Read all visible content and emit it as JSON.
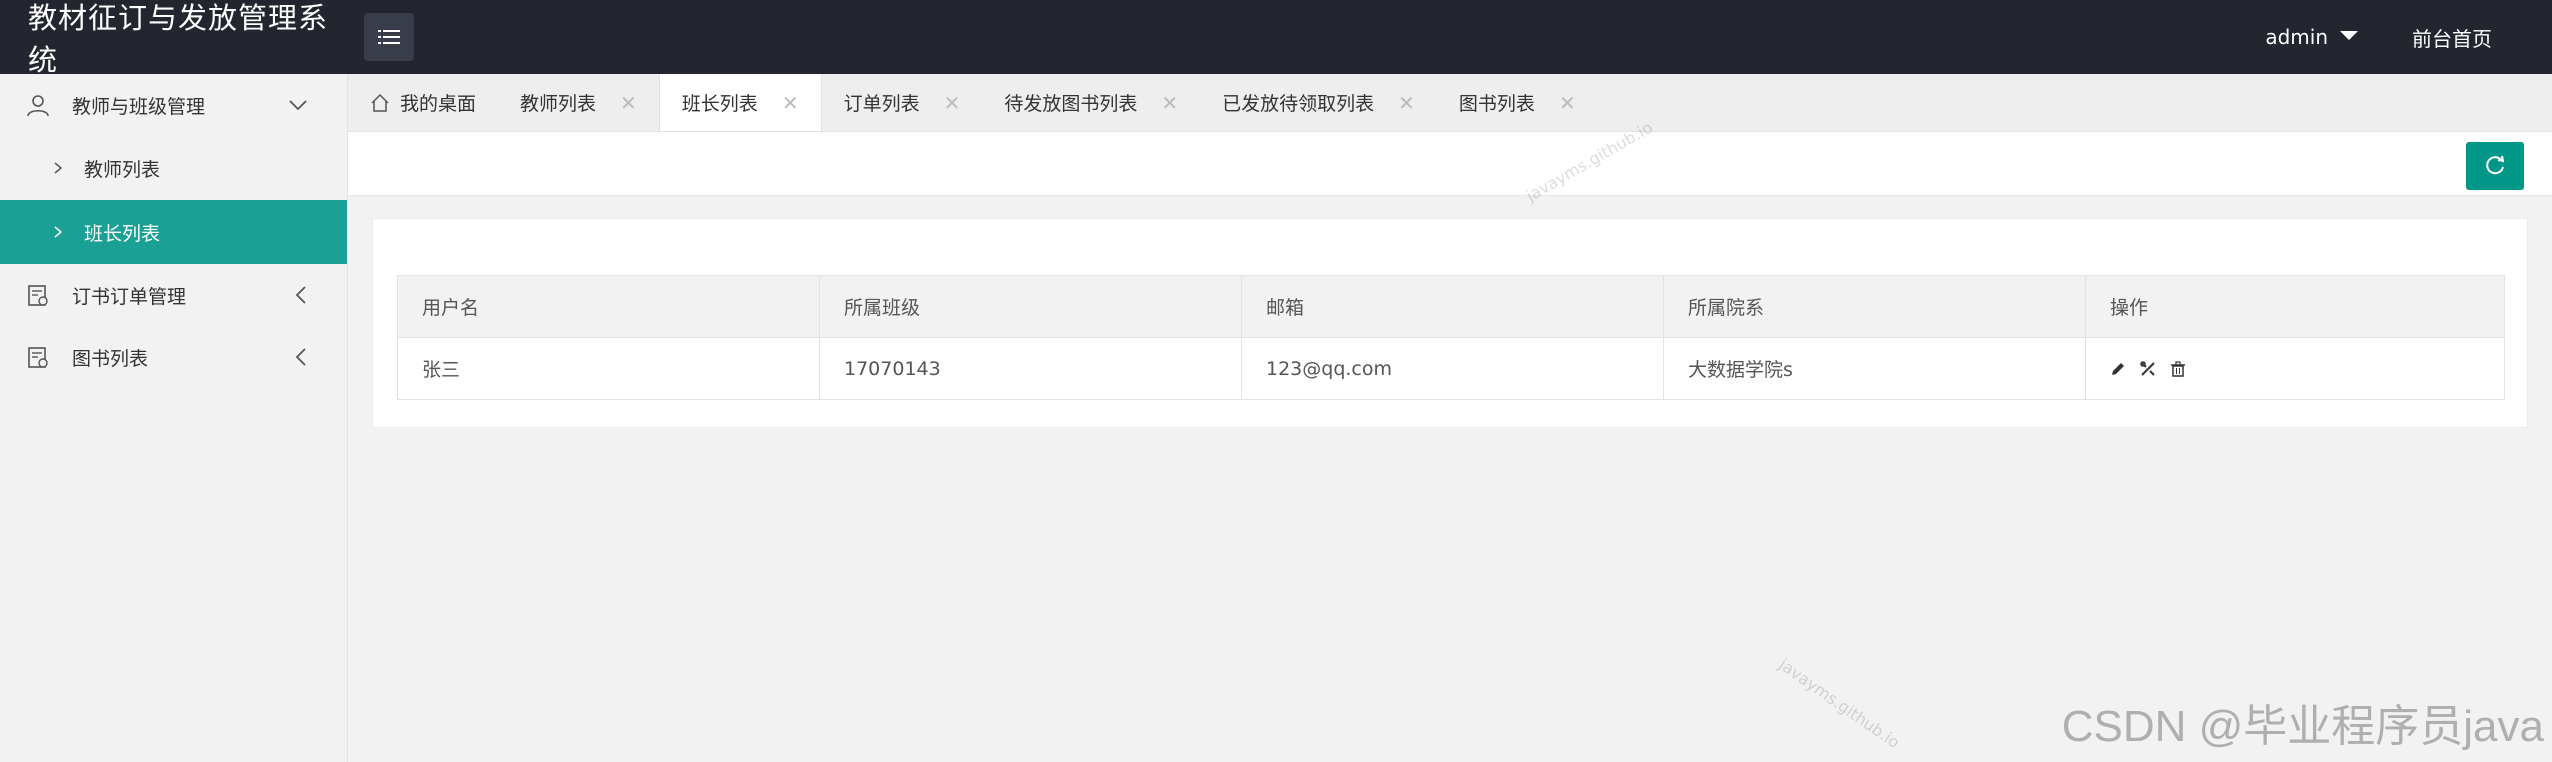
{
  "app": {
    "title": "教材征订与发放管理系统"
  },
  "header": {
    "user": "admin",
    "front_link": "前台首页"
  },
  "sidebar": {
    "groups": [
      {
        "label": "教师与班级管理",
        "icon": "user-icon",
        "expanded": true,
        "items": [
          {
            "label": "教师列表",
            "active": false
          },
          {
            "label": "班长列表",
            "active": true
          }
        ]
      },
      {
        "label": "订书订单管理",
        "icon": "calendar-icon",
        "expanded": false
      },
      {
        "label": "图书列表",
        "icon": "calendar-icon",
        "expanded": false
      }
    ]
  },
  "tabs": [
    {
      "label": "我的桌面",
      "icon": "home-icon",
      "closable": false,
      "active": false
    },
    {
      "label": "教师列表",
      "closable": true,
      "active": false
    },
    {
      "label": "班长列表",
      "closable": true,
      "active": true
    },
    {
      "label": "订单列表",
      "closable": true,
      "active": false
    },
    {
      "label": "待发放图书列表",
      "closable": true,
      "active": false
    },
    {
      "label": "已发放待领取列表",
      "closable": true,
      "active": false
    },
    {
      "label": "图书列表",
      "closable": true,
      "active": false
    }
  ],
  "table": {
    "columns": [
      "用户名",
      "所属班级",
      "邮箱",
      "所属院系",
      "操作"
    ],
    "rows": [
      {
        "username": "张三",
        "class": "17070143",
        "email": "123@qq.com",
        "department": "大数据学院s"
      }
    ]
  },
  "watermarks": {
    "repo": "javayms.github.io",
    "csdn": "CSDN @毕业程序员java"
  },
  "colors": {
    "header_bg": "#23262e",
    "accent": "#009688",
    "active_menu": "#1aa094"
  }
}
